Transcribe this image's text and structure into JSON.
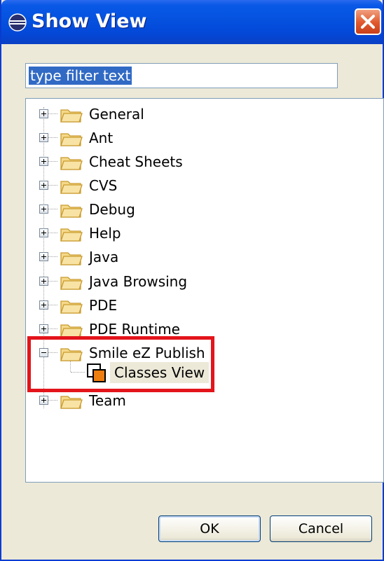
{
  "window": {
    "title": "Show View"
  },
  "filter": {
    "value": "type filter text"
  },
  "tree": {
    "items": [
      {
        "label": "General",
        "expanded": false
      },
      {
        "label": "Ant",
        "expanded": false
      },
      {
        "label": "Cheat Sheets",
        "expanded": false
      },
      {
        "label": "CVS",
        "expanded": false
      },
      {
        "label": "Debug",
        "expanded": false
      },
      {
        "label": "Help",
        "expanded": false
      },
      {
        "label": "Java",
        "expanded": false
      },
      {
        "label": "Java Browsing",
        "expanded": false
      },
      {
        "label": "PDE",
        "expanded": false
      },
      {
        "label": "PDE Runtime",
        "expanded": false
      },
      {
        "label": "Smile eZ Publish",
        "expanded": true
      },
      {
        "label": "Team",
        "expanded": false
      }
    ],
    "child": {
      "label": "Classes View"
    }
  },
  "buttons": {
    "ok": "OK",
    "cancel": "Cancel"
  },
  "colors": {
    "titlebar": "#0553e0",
    "highlight_box": "#e3141b",
    "selection": "#316ac5"
  }
}
